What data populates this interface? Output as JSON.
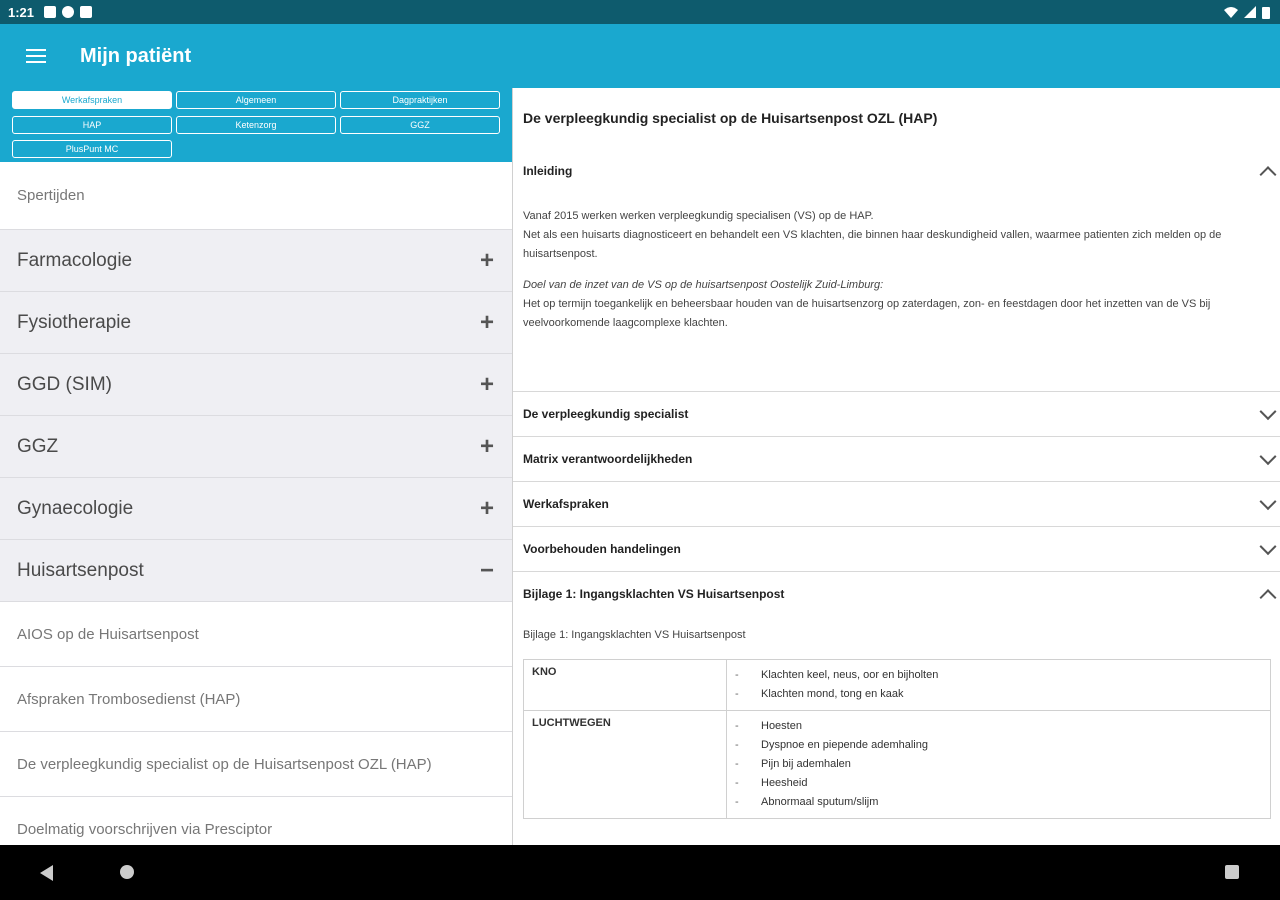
{
  "status": {
    "time": "1:21"
  },
  "app": {
    "title": "Mijn patiënt"
  },
  "tabs": [
    {
      "label": "Werkafspraken",
      "active": true
    },
    {
      "label": "Algemeen"
    },
    {
      "label": "Dagpraktijken"
    },
    {
      "label": "HAP"
    },
    {
      "label": "Ketenzorg"
    },
    {
      "label": "GGZ"
    },
    {
      "label": "PlusPunt MC"
    }
  ],
  "left": {
    "top_item": "Spertijden",
    "categories": [
      {
        "label": "Farmacologie",
        "sign": "+"
      },
      {
        "label": "Fysiotherapie",
        "sign": "+"
      },
      {
        "label": "GGD (SIM)",
        "sign": "+"
      },
      {
        "label": "GGZ",
        "sign": "+"
      },
      {
        "label": "Gynaecologie",
        "sign": "+"
      },
      {
        "label": "Huisartsenpost",
        "sign": "−"
      }
    ],
    "sub_items": [
      "AIOS op de Huisartsenpost",
      "Afspraken Trombosedienst (HAP)",
      "De verpleegkundig specialist op de Huisartsenpost OZL (HAP)",
      "Doelmatig voorschrijven via Presciptor"
    ]
  },
  "right": {
    "title": "De verpleegkundig specialist op de Huisartsenpost OZL (HAP)",
    "intro": {
      "header": "Inleiding",
      "p1_line1": "Vanaf 2015 werken werken verpleegkundig specialisen (VS) op de HAP.",
      "p1_line2": "Net als een huisarts diagnosticeert en behandelt een VS klachten, die binnen haar deskundigheid vallen, waarmee patienten zich melden op de huisartsenpost.",
      "p2_italic": "Doel van de inzet van de VS op de huisartsenpost Oostelijk Zuid-Limburg:",
      "p2_text": "Het op termijn toegankelijk en beheersbaar houden van de huisartsenzorg op zaterdagen, zon- en feestdagen door het inzetten van de VS bij veelvoorkomende laagcomplexe klachten."
    },
    "sections": [
      "De verpleegkundig specialist",
      "Matrix verantwoordelijkheden",
      "Werkafspraken",
      "Voorbehouden handelingen"
    ],
    "bijlage": {
      "header": "Bijlage 1: Ingangsklachten VS Huisartsenpost",
      "subtitle": "Bijlage 1: Ingangsklachten VS Huisartsenpost",
      "table": [
        {
          "cat": "KNO",
          "items": [
            "Klachten keel, neus, oor en bijholten",
            "Klachten mond, tong en kaak"
          ]
        },
        {
          "cat": "LUCHTWEGEN",
          "items": [
            "Hoesten",
            "Dyspnoe en piepende ademhaling",
            "Pijn bij ademhalen",
            "Heesheid",
            "Abnormaal sputum/slijm"
          ]
        }
      ]
    }
  }
}
